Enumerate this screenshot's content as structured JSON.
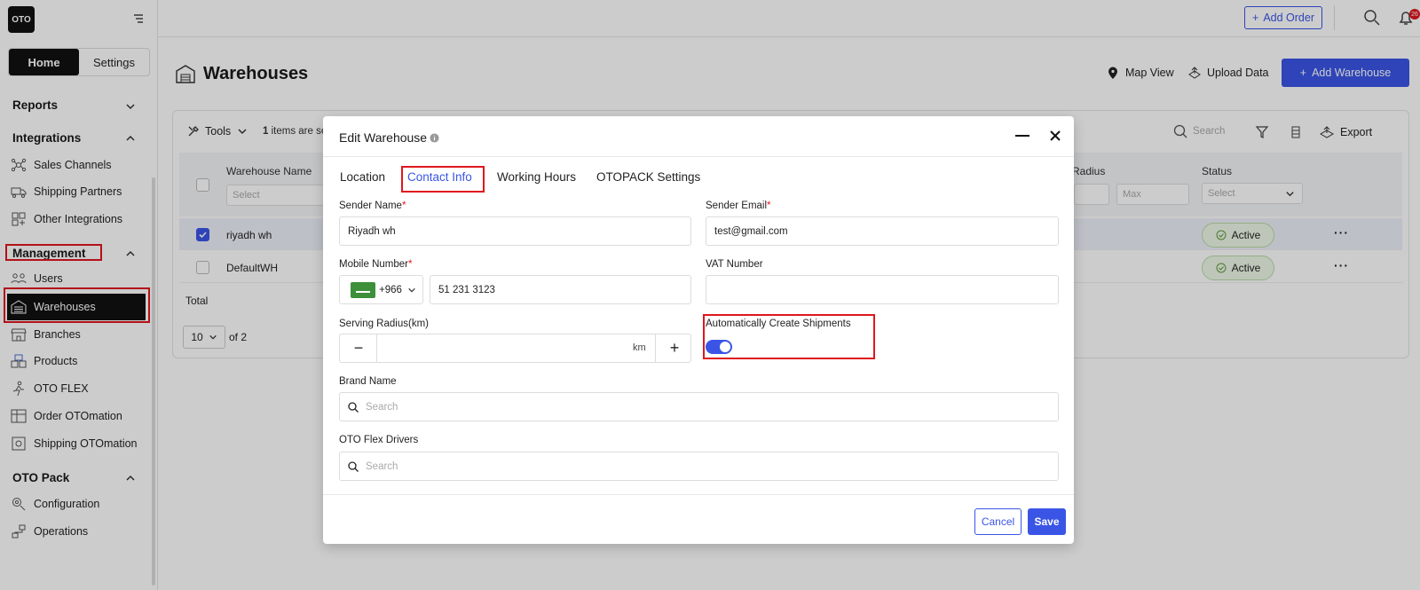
{
  "sidebar": {
    "logo": "OTO",
    "tabs": {
      "home": "Home",
      "settings": "Settings"
    },
    "reports": "Reports",
    "integrations": {
      "title": "Integrations",
      "items": [
        "Sales Channels",
        "Shipping Partners",
        "Other Integrations"
      ]
    },
    "management": {
      "title": "Management",
      "items": [
        "Users",
        "Warehouses",
        "Branches",
        "Products",
        "OTO FLEX",
        "Order OTOmation",
        "Shipping OTOmation"
      ]
    },
    "otopack": {
      "title": "OTO Pack",
      "items": [
        "Configuration",
        "Operations"
      ]
    }
  },
  "header": {
    "add_order": "Add Order",
    "notification_count": "26"
  },
  "page": {
    "title": "Warehouses",
    "map_view": "Map View",
    "upload_data": "Upload Data",
    "add_warehouse": "Add Warehouse"
  },
  "table": {
    "tools": "Tools",
    "items_selected_count": "1",
    "items_selected_text": "items are se",
    "search_placeholder": "Search",
    "export": "Export",
    "columns": {
      "name": "Warehouse Name",
      "radius": "Radius",
      "status": "Status"
    },
    "filters": {
      "name_placeholder": "Select",
      "max_placeholder": "Max",
      "status_placeholder": "Select"
    },
    "rows": [
      {
        "name": "riyadh wh",
        "status": "Active"
      },
      {
        "name": "DefaultWH",
        "status": "Active"
      }
    ],
    "total": "Total",
    "page_size": "10",
    "page_of": "of 2"
  },
  "modal": {
    "title": "Edit Warehouse",
    "tabs": [
      "Location",
      "Contact Info",
      "Working Hours",
      "OTOPACK Settings"
    ],
    "sender_name": {
      "label": "Sender Name",
      "value": "Riyadh wh"
    },
    "sender_email": {
      "label": "Sender Email",
      "value": "test@gmail.com"
    },
    "mobile": {
      "label": "Mobile Number",
      "code": "+966",
      "value": "51 231 3123"
    },
    "vat": {
      "label": "VAT Number",
      "value": ""
    },
    "radius": {
      "label": "Serving Radius(km)",
      "minus": "−",
      "plus": "+",
      "unit": "km",
      "value": ""
    },
    "auto_ship": {
      "label": "Automatically Create Shipments",
      "enabled": true
    },
    "brand": {
      "label": "Brand Name",
      "placeholder": "Search"
    },
    "drivers": {
      "label": "OTO Flex Drivers",
      "placeholder": "Search"
    },
    "cancel": "Cancel",
    "save": "Save"
  },
  "colors": {
    "accent": "#3a55e6",
    "highlight": "#e0161e",
    "success_bg": "#eef8e8"
  }
}
